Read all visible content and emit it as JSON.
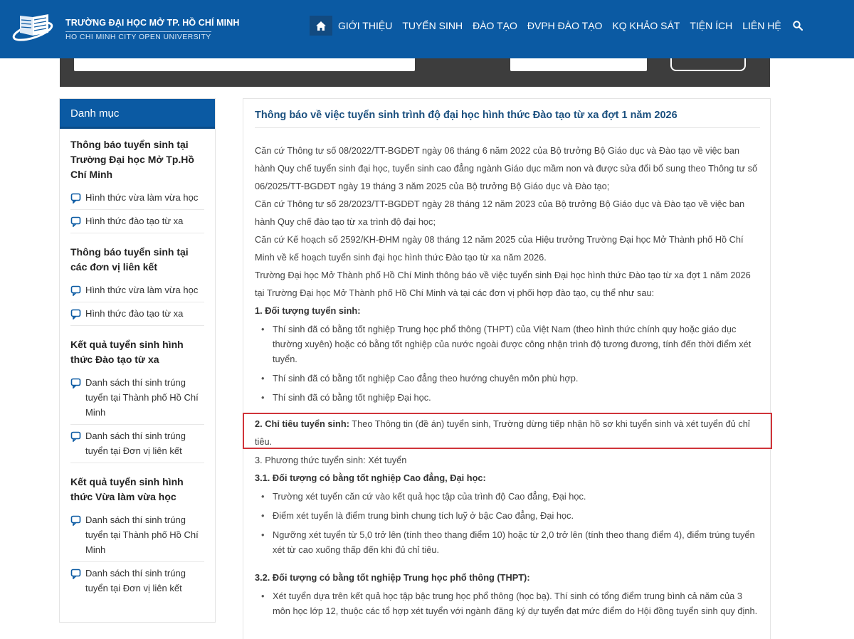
{
  "header": {
    "logo_title": "TRƯỜNG ĐẠI HỌC MỞ TP. HỒ CHÍ MINH",
    "logo_subtitle": "HO CHI MINH CITY OPEN UNIVERSITY",
    "nav": [
      "GIỚI THIỆU",
      "TUYỂN SINH",
      "ĐÀO TẠO",
      "ĐVPH ĐÀO TẠO",
      "KQ KHẢO SÁT",
      "TIỆN ÍCH",
      "LIÊN HỆ"
    ],
    "accent": "#0b5aa3"
  },
  "sidebar": {
    "title": "Danh mục",
    "sections": [
      {
        "title": "Thông báo tuyển sinh tại Trường Đại học Mở Tp.Hồ Chí Minh",
        "items": [
          "Hình thức vừa làm vừa học",
          "Hình thức đào tạo từ xa"
        ]
      },
      {
        "title": "Thông báo tuyển sinh tại các đơn vị liên kết",
        "items": [
          "Hình thức vừa làm vừa học",
          "Hình thức đào tạo từ xa"
        ]
      },
      {
        "title": "Kết quả tuyển sinh hình thức Đào tạo từ xa",
        "items": [
          "Danh sách thí sinh trúng tuyển tại Thành phố Hồ Chí Minh",
          "Danh sách thí sinh trúng tuyển tại Đơn vị liên kết"
        ]
      },
      {
        "title": "Kết quả tuyển sinh hình thức Vừa làm vừa học",
        "items": [
          "Danh sách thí sinh trúng tuyển tại Thành phố Hồ Chí Minh",
          "Danh sách thí sinh trúng tuyển tại Đơn vị liên kết"
        ]
      }
    ]
  },
  "article": {
    "title": "Thông báo về việc tuyển sinh trình độ đại học hình thức Đào tạo từ xa đợt 1 năm 2026",
    "p1": "Căn cứ Thông tư số 08/2022/TT-BGDĐT ngày 06 tháng 6 năm 2022 của Bộ trưởng Bộ Giáo dục và Đào tạo về việc ban hành Quy chế tuyển sinh đại học, tuyển sinh cao đẳng ngành Giáo dục mầm non và được sửa đổi bổ sung theo Thông tư số 06/2025/TT-BGDĐT ngày 19 tháng 3 năm 2025 của Bộ trưởng Bộ Giáo dục và Đào tạo;",
    "p2": "Căn cứ Thông tư số 28/2023/TT-BGDĐT ngày 28 tháng 12 năm 2023 của Bộ trưởng Bộ Giáo dục và Đào tạo về việc ban hành Quy chế đào tạo từ xa trình độ đại học;",
    "p3": "Căn cứ Kế hoạch số 2592/KH-ĐHM ngày 08 tháng 12 năm 2025 của Hiệu trưởng Trường Đại học Mở Thành phố Hồ Chí Minh về kế hoạch tuyển sinh đại học hình thức Đào tạo từ xa năm 2026.",
    "p4": "Trường Đại học Mở Thành phố Hồ Chí Minh thông báo về việc tuyển sinh Đại học hình thức Đào tạo từ xa đợt 1 năm 2026 tại Trường Đại học Mở Thành phố Hồ Chí Minh và tại các đơn vị phối hợp đào tạo, cụ thể như sau:",
    "s1_title": "1. Đối tượng tuyển sinh:",
    "s1_items": [
      "Thí sinh đã có bằng tốt nghiệp Trung học phổ thông (THPT) của Việt Nam (theo hình thức chính quy hoặc giáo dục thường xuyên) hoặc có bằng tốt nghiệp của nước ngoài được công nhận trình độ tương đương, tính đến thời điểm xét tuyển.",
      "Thí sinh đã có bằng tốt nghiệp Cao đẳng theo hướng chuyên môn phù hợp.",
      "Thí sinh đã có bằng tốt nghiệp Đại học."
    ],
    "s2_title": "2. Chỉ tiêu tuyển sinh:",
    "s2_text": " Theo Thông tin (đề án) tuyển sinh, Trường dừng tiếp nhận hồ sơ khi tuyển sinh và xét tuyển đủ chỉ tiêu.",
    "s3_title": "3. Phương thức tuyển sinh:",
    "s3_text": " Xét tuyển",
    "s31_title": "3.1. Đối tượng có bằng tốt nghiệp Cao đẳng, Đại học:",
    "s31_items": [
      "Trường xét tuyển căn cứ vào kết quả học tập của trình độ Cao đẳng, Đại học.",
      "Điểm xét tuyển là điểm trung bình chung tích luỹ ở bậc Cao đẳng, Đại học.",
      "Ngưỡng xét tuyển từ 5,0 trở lên (tính theo thang điểm 10) hoặc từ 2,0 trở lên (tính theo thang điểm 4), điểm trúng tuyển xét từ cao xuống thấp đến khi đủ chỉ tiêu."
    ],
    "s32_title": "3.2. Đối tượng có bằng tốt nghiệp Trung học phổ thông (THPT):",
    "s32_items": [
      "Xét tuyển dựa trên kết quả học tập bậc trung học phổ thông (học bạ). Thí sinh có tổng điểm trung bình cả năm của 3 môn học lớp 12, thuộc các tổ hợp xét tuyển với ngành đăng ký dự tuyển đạt mức điểm do Hội đồng tuyển sinh quy định."
    ],
    "highlight_color": "#d0343a"
  }
}
